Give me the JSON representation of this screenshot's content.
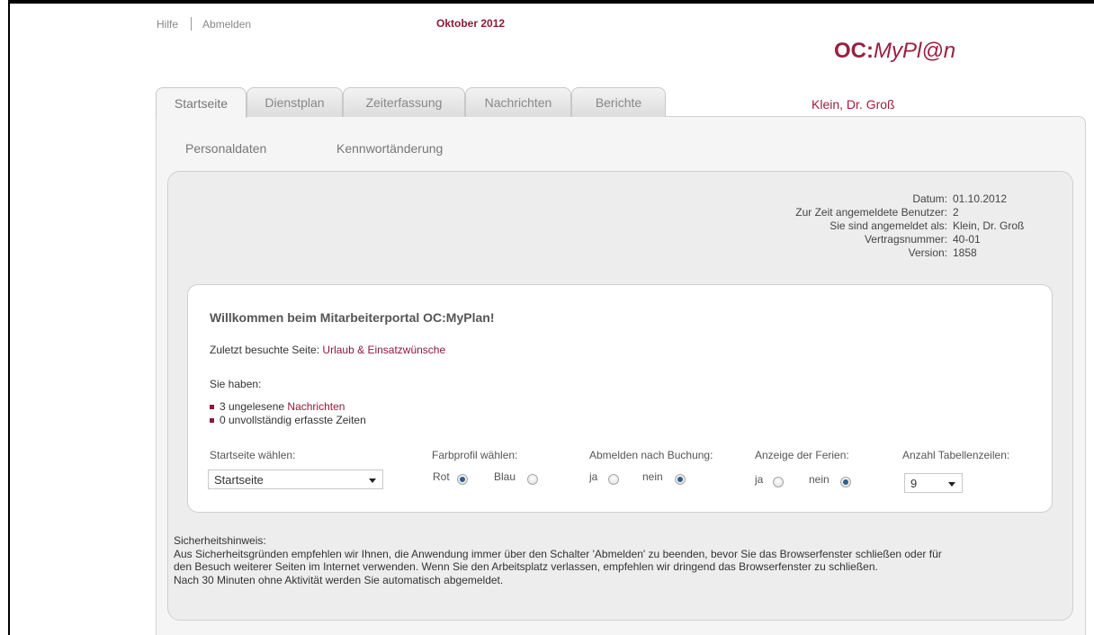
{
  "header": {
    "help_label": "Hilfe",
    "logout_label": "Abmelden",
    "month": "Oktober 2012",
    "logo_oc": "OC:",
    "logo_myplan": "MyPl@n",
    "user_name": "Klein, Dr. Groß"
  },
  "tabs": [
    {
      "label": "Startseite",
      "active": true
    },
    {
      "label": "Dienstplan"
    },
    {
      "label": "Zeiterfassung"
    },
    {
      "label": "Nachrichten"
    },
    {
      "label": "Berichte"
    }
  ],
  "subnav": [
    {
      "label": "Personaldaten"
    },
    {
      "label": "Kennwortänderung"
    }
  ],
  "info": {
    "rows": [
      {
        "label": "Datum:",
        "value": "01.10.2012"
      },
      {
        "label": "Zur Zeit angemeldete Benutzer:",
        "value": "2"
      },
      {
        "label": "Sie sind angemeldet als:",
        "value": "Klein, Dr. Groß"
      },
      {
        "label": "Vertragsnummer:",
        "value": "40-01"
      },
      {
        "label": "Version:",
        "value": "1858"
      }
    ]
  },
  "welcome": {
    "title": "Willkommen beim Mitarbeiterportal OC:MyPlan!",
    "last_page_label": "Zuletzt besuchte Seite:",
    "last_page_link": "Urlaub & Einsatzwünsche",
    "you_have": "Sie haben:",
    "bullet1_prefix": "3 ungelesene",
    "bullet1_link": "Nachrichten",
    "bullet2": "0 unvollständig erfasste Zeiten"
  },
  "options": {
    "startpage_label": "Startseite wählen:",
    "startpage_value": "Startseite",
    "color_label": "Farbprofil wählen:",
    "color_rot": "Rot",
    "color_blau": "Blau",
    "color_selected": "Rot",
    "logout_label": "Abmelden nach Buchung:",
    "logout_ja": "ja",
    "logout_nein": "nein",
    "logout_selected": "nein",
    "holidays_label": "Anzeige der Ferien:",
    "holidays_ja": "ja",
    "holidays_nein": "nein",
    "holidays_selected": "nein",
    "rows_label": "Anzahl Tabellenzeilen:",
    "rows_value": "9"
  },
  "security": {
    "title": "Sicherheitshinweis:",
    "line1": "Aus Sicherheitsgründen empfehlen wir Ihnen, die Anwendung immer über den Schalter 'Abmelden' zu beenden, bevor Sie das Browserfenster schließen oder für",
    "line2": "den Besuch weiterer Seiten im Internet verwenden. Wenn Sie den Arbeitsplatz verlassen, empfehlen wir dringend das Browserfenster zu schließen.",
    "line3": "Nach 30 Minuten ohne Aktivität werden Sie automatisch abgemeldet."
  },
  "colors": {
    "brand": "#9b1f3f",
    "link": "#8b1a3a",
    "radio_selected": "#2c5f8a"
  }
}
